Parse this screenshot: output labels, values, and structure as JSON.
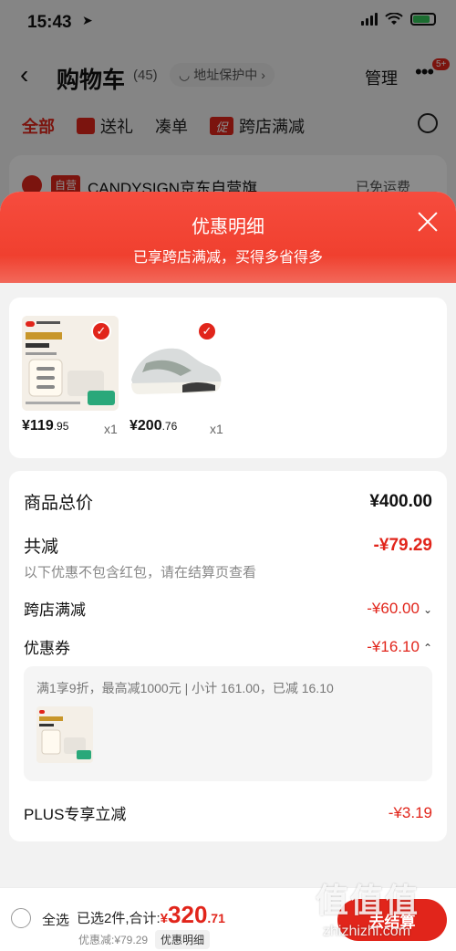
{
  "status_bar": {
    "time": "15:43"
  },
  "cart_header": {
    "title": "购物车",
    "count": "(45)",
    "address_protect": "地址保护中",
    "manage": "管理",
    "more_badge": "5+"
  },
  "filter_tabs": [
    {
      "label": "全部",
      "active": true
    },
    {
      "label": "送礼"
    },
    {
      "label": "凑单"
    },
    {
      "label": "跨店满减",
      "icon_text": "促"
    }
  ],
  "store": {
    "tag": "自营",
    "name": "CANDYSIGN京东自营旗…",
    "shipping": "已免运费"
  },
  "sheet": {
    "title": "优惠明细",
    "subtitle": "已享跨店满减，买得多省得多"
  },
  "products": [
    {
      "name_icon": "charger-product-image",
      "price_int": "¥119",
      "price_dec": ".95",
      "qty": "x1"
    },
    {
      "name_icon": "sneaker-product-image",
      "price_int": "¥200",
      "price_dec": ".76",
      "qty": "x1"
    }
  ],
  "summary": {
    "total_label": "商品总价",
    "total_value": "¥400.00",
    "reduce_label": "共减",
    "reduce_value": "-¥79.29",
    "note": "以下优惠不包含红包，请在结算页查看",
    "cross_store_label": "跨店满减",
    "cross_store_value": "-¥60.00",
    "coupon_label": "优惠券",
    "coupon_value": "-¥16.10",
    "coupon_desc": "满1享9折，最高减1000元 | 小计 161.00，已减 16.10",
    "plus_label": "PLUS专享立减",
    "plus_value": "-¥3.19"
  },
  "bottom_bar": {
    "select_all": "全选",
    "selected_text": "已选2件,合计:",
    "currency": "¥",
    "total_int": "320",
    "total_dec": ".71",
    "discount_text": "优惠减:¥79.29",
    "detail_button": "优惠明细",
    "checkout": "去结算"
  },
  "watermark": {
    "chars": "值值值",
    "url": "zhizhizhi.com"
  },
  "colors": {
    "accent": "#e1251b",
    "sheet_header": "#f0402f"
  }
}
